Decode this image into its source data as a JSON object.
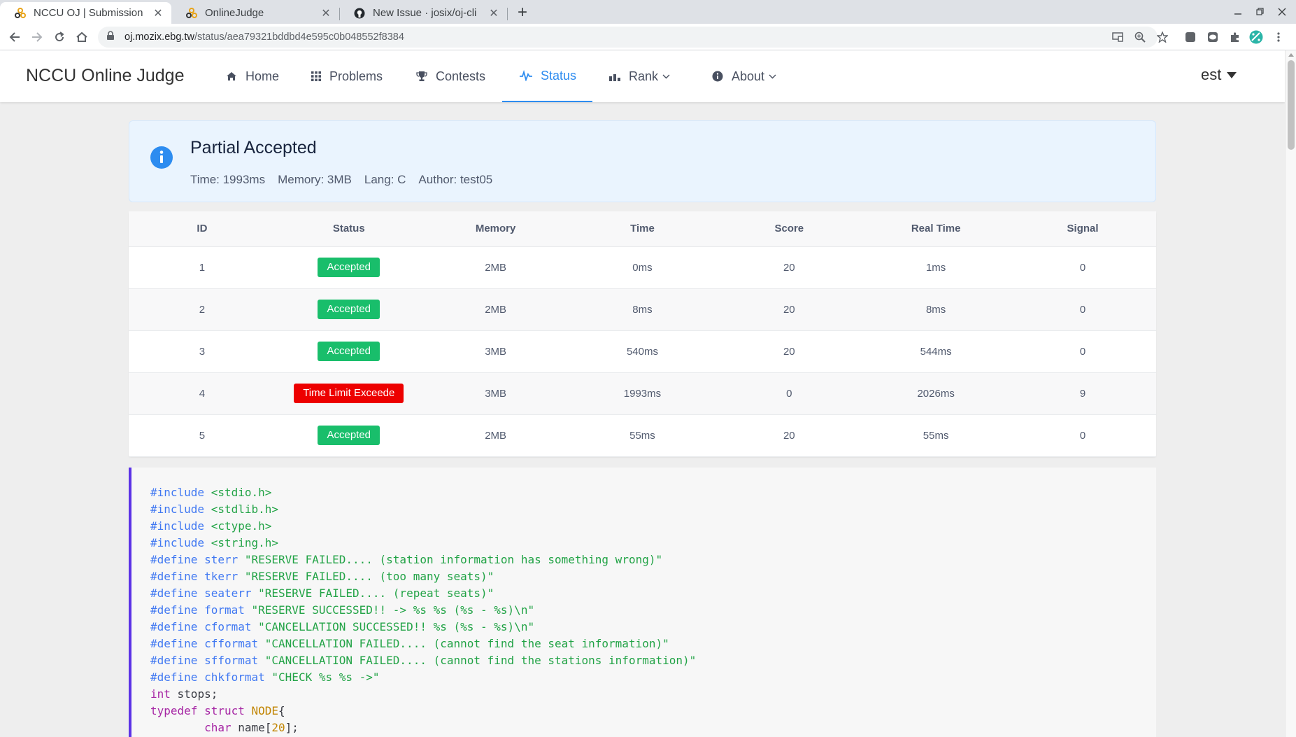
{
  "browser": {
    "tabs": [
      {
        "title": "NCCU OJ | Submission De",
        "active": true
      },
      {
        "title": "OnlineJudge",
        "active": false
      },
      {
        "title": "New Issue · josix/oj-cli",
        "active": false
      }
    ],
    "url_domain": "oj.mozix.ebg.tw",
    "url_path": "/status/aea79321bddbd4e595c0b048552f8384"
  },
  "nav": {
    "brand": "NCCU Online Judge",
    "items": [
      {
        "label": "Home",
        "icon": "home-icon"
      },
      {
        "label": "Problems",
        "icon": "grid-icon"
      },
      {
        "label": "Contests",
        "icon": "trophy-icon"
      },
      {
        "label": "Status",
        "icon": "pulse-icon",
        "active": true
      },
      {
        "label": "Rank",
        "icon": "bar-chart-icon",
        "dropdown": true
      },
      {
        "label": "About",
        "icon": "info-icon",
        "dropdown": true
      }
    ],
    "user": "est"
  },
  "result": {
    "title": "Partial Accepted",
    "time": "Time: 1993ms",
    "memory": "Memory: 3MB",
    "lang": "Lang: C",
    "author": "Author: test05",
    "accent": "#2d8cf0"
  },
  "cases": {
    "headers": [
      "ID",
      "Status",
      "Memory",
      "Time",
      "Score",
      "Real Time",
      "Signal"
    ],
    "rows": [
      {
        "id": "1",
        "status": "Accepted",
        "memory": "2MB",
        "time": "0ms",
        "score": "20",
        "real_time": "1ms",
        "signal": "0"
      },
      {
        "id": "2",
        "status": "Accepted",
        "memory": "2MB",
        "time": "8ms",
        "score": "20",
        "real_time": "8ms",
        "signal": "0"
      },
      {
        "id": "3",
        "status": "Accepted",
        "memory": "3MB",
        "time": "540ms",
        "score": "20",
        "real_time": "544ms",
        "signal": "0"
      },
      {
        "id": "4",
        "status": "Time Limit Exceede",
        "memory": "3MB",
        "time": "1993ms",
        "score": "0",
        "real_time": "2026ms",
        "signal": "9"
      },
      {
        "id": "5",
        "status": "Accepted",
        "memory": "2MB",
        "time": "55ms",
        "score": "20",
        "real_time": "55ms",
        "signal": "0"
      }
    ],
    "colors": {
      "accepted": "#19be6b",
      "tle": "#ed0000"
    }
  },
  "code": {
    "lines": [
      "#include <stdio.h>",
      "#include <stdlib.h>",
      "#include <ctype.h>",
      "#include <string.h>",
      "#define sterr \"RESERVE FAILED.... (station information has something wrong)\"",
      "#define tkerr \"RESERVE FAILED.... (too many seats)\"",
      "#define seaterr \"RESERVE FAILED.... (repeat seats)\"",
      "#define format \"RESERVE SUCCESSED!! -> %s %s (%s - %s)\\n\"",
      "#define cformat \"CANCELLATION SUCCESSED!! %s (%s - %s)\\n\"",
      "#define cfformat \"CANCELLATION FAILED.... (cannot find the seat information)\"",
      "#define sfformat \"CANCELLATION FAILED.... (cannot find the stations information)\"",
      "#define chkformat \"CHECK %s %s ->\"",
      "int stops;",
      "typedef struct NODE{",
      "        char name[20];"
    ]
  }
}
